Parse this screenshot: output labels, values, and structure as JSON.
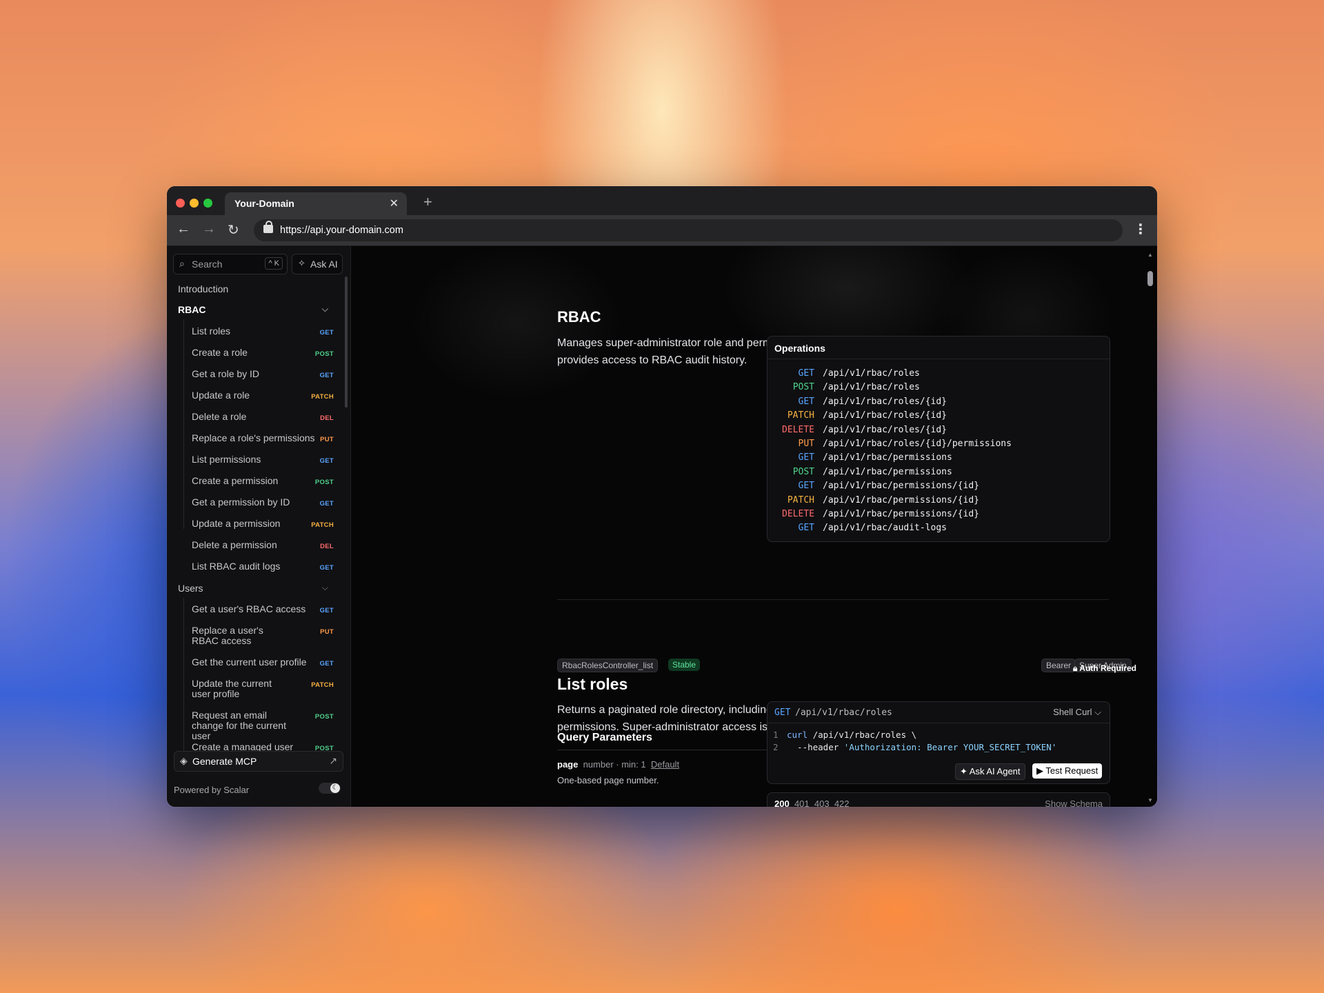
{
  "browser": {
    "tab_title": "Your-Domain",
    "tab_close": "✕",
    "new_tab": "+",
    "url": "https://api.your-domain.com",
    "nav": {
      "back": "←",
      "forward": "→",
      "reload": "↻",
      "menu": "⋮"
    }
  },
  "sidebar": {
    "search_placeholder": "Search",
    "search_shortcut": "^ K",
    "ask_ai": "Ask AI",
    "introduction": "Introduction",
    "groups": [
      {
        "label": "RBAC",
        "items": [
          {
            "label": "List roles",
            "method": "GET"
          },
          {
            "label": "Create a role",
            "method": "POST"
          },
          {
            "label": "Get a role by ID",
            "method": "GET"
          },
          {
            "label": "Update a role",
            "method": "PATCH"
          },
          {
            "label": "Delete a role",
            "method": "DEL"
          },
          {
            "label": "Replace a role's permissions",
            "method": "PUT"
          },
          {
            "label": "List permissions",
            "method": "GET"
          },
          {
            "label": "Create a permission",
            "method": "POST"
          },
          {
            "label": "Get a permission by ID",
            "method": "GET"
          },
          {
            "label": "Update a permission",
            "method": "PATCH"
          },
          {
            "label": "Delete a permission",
            "method": "DEL"
          },
          {
            "label": "List RBAC audit logs",
            "method": "GET"
          }
        ]
      },
      {
        "label": "Users",
        "items": [
          {
            "label": "Get a user's RBAC access",
            "method": "GET"
          },
          {
            "label": "Replace a user's RBAC access",
            "method": "PUT"
          },
          {
            "label": "Get the current user profile",
            "method": "GET"
          },
          {
            "label": "Update the current user profile",
            "method": "PATCH"
          },
          {
            "label": "Request an email change for the current user",
            "method": "POST"
          },
          {
            "label": "Create a managed user",
            "method": "POST"
          }
        ]
      }
    ],
    "generate_mcp": "Generate MCP",
    "powered_by": "Powered by Scalar"
  },
  "tag_section": {
    "title": "RBAC",
    "description": "Manages super-administrator role and permission configuration and provides access to RBAC audit history.",
    "operations_title": "Operations",
    "operations": [
      {
        "method": "GET",
        "path": "/api/v1/rbac/roles"
      },
      {
        "method": "POST",
        "path": "/api/v1/rbac/roles"
      },
      {
        "method": "GET",
        "path": "/api/v1/rbac/roles/{id}"
      },
      {
        "method": "PATCH",
        "path": "/api/v1/rbac/roles/{id}"
      },
      {
        "method": "DELETE",
        "path": "/api/v1/rbac/roles/{id}"
      },
      {
        "method": "PUT",
        "path": "/api/v1/rbac/roles/{id}/permissions"
      },
      {
        "method": "GET",
        "path": "/api/v1/rbac/permissions"
      },
      {
        "method": "POST",
        "path": "/api/v1/rbac/permissions"
      },
      {
        "method": "GET",
        "path": "/api/v1/rbac/permissions/{id}"
      },
      {
        "method": "PATCH",
        "path": "/api/v1/rbac/permissions/{id}"
      },
      {
        "method": "DELETE",
        "path": "/api/v1/rbac/permissions/{id}"
      },
      {
        "method": "GET",
        "path": "/api/v1/rbac/audit-logs"
      }
    ]
  },
  "operation": {
    "operation_id": "RbacRolesController_list",
    "status": "Stable",
    "auth_badges": [
      "Bearer",
      "Super Admin"
    ],
    "auth_required": "Auth Required",
    "title": "List roles",
    "description": "Returns a paginated role directory, including each role's assigned permissions. Super-administrator access is required.",
    "query_params_title": "Query Parameters",
    "param": {
      "name": "page",
      "meta": "number · min:  1",
      "default_label": "Default",
      "description": "One-based page number."
    },
    "request": {
      "method": "GET",
      "path": "/api/v1/rbac/roles",
      "lang": "Shell Curl",
      "code_lines": [
        {
          "n": "1",
          "cmd": "curl",
          "rest": " /api/v1/rbac/roles \\"
        },
        {
          "n": "2",
          "flag": "  --header ",
          "str": "'Authorization: Bearer YOUR_SECRET_TOKEN'"
        }
      ],
      "ask_agent": "Ask AI Agent",
      "test_request": "Test Request"
    },
    "responses": {
      "codes": [
        "200",
        "401",
        "403",
        "422"
      ],
      "show_schema": "Show Schema"
    }
  },
  "colors": {
    "get": "#5aa4ff",
    "post": "#4fd18b",
    "patch": "#f5b041",
    "delete": "#ff6b6b",
    "put": "#ff9a4a"
  }
}
